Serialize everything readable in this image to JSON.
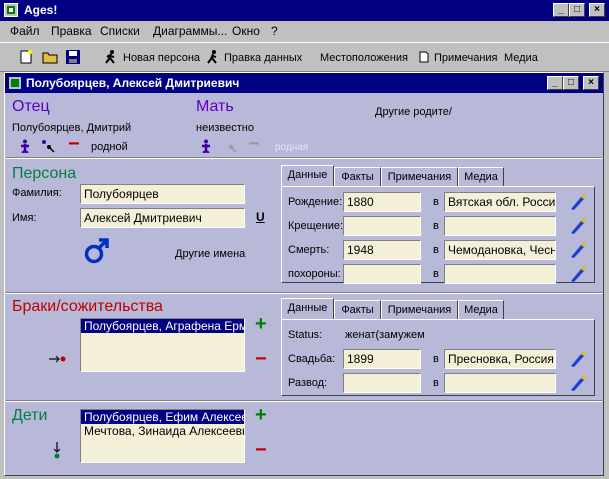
{
  "app": {
    "title": "Ages!"
  },
  "menu": [
    "Файл",
    "Правка",
    "Списки",
    "Диаграммы...",
    "Окно",
    "?"
  ],
  "toolbar": {
    "new_person": "Новая персона",
    "edit_data": "Правка данных",
    "locations": "Местоположения",
    "notes": "Примечания",
    "media": "Медиа"
  },
  "person_window": {
    "title": "Полубоярцев, Алексей Дмитриевич"
  },
  "parents": {
    "father_label": "Отец",
    "father_name": "Полубоярцев, Дмитрий",
    "father_relation": "родной",
    "mother_label": "Мать",
    "mother_name": "неизвестно",
    "mother_relation": "родная",
    "other_parents": "Другие родите/"
  },
  "person": {
    "heading": "Персона",
    "surname_label": "Фамилия:",
    "surname": "Полубоярцев",
    "name_label": "Имя:",
    "name": "Алексей Дмитриевич",
    "underline_btn": "U",
    "other_names": "Другие имена"
  },
  "data_tabs": [
    "Данные",
    "Факты",
    "Примечания",
    "Медиа"
  ],
  "events": [
    {
      "label": "Рождение:",
      "date": "1880",
      "in": "в",
      "place": "Вятская обл. Россия"
    },
    {
      "label": "Крещение:",
      "date": "",
      "in": "в",
      "place": ""
    },
    {
      "label": "Смерть:",
      "date": "1948",
      "in": "в",
      "place": "Чемодановка, Чесн"
    },
    {
      "label": "похороны:",
      "date": "",
      "in": "в",
      "place": ""
    }
  ],
  "marriages": {
    "heading": "Браки/сожительства",
    "list": [
      "Полубоярцев, Аграфена Ермо"
    ],
    "tabs": [
      "Данные",
      "Факты",
      "Примечания",
      "Медиа"
    ],
    "status_label": "Status:",
    "status_value": "женат(замужем",
    "wedding_label": "Свадьба:",
    "wedding_date": "1899",
    "wedding_in": "в",
    "wedding_place": "Пресновка, Россия",
    "divorce_label": "Развод:",
    "divorce_date": "",
    "divorce_in": "в",
    "divorce_place": ""
  },
  "children": {
    "heading": "Дети",
    "list": [
      "Полубоярцев, Ефим Алексееви",
      "Мечтова, Зинаида Алексеевна"
    ]
  },
  "colors": {
    "heading_violet": "#6000c0",
    "heading_green": "#008040",
    "heading_red": "#c00000",
    "field_bg": "#f4f0d8",
    "panel_bg": "#b8b8d8",
    "title_bg": "#000080"
  }
}
